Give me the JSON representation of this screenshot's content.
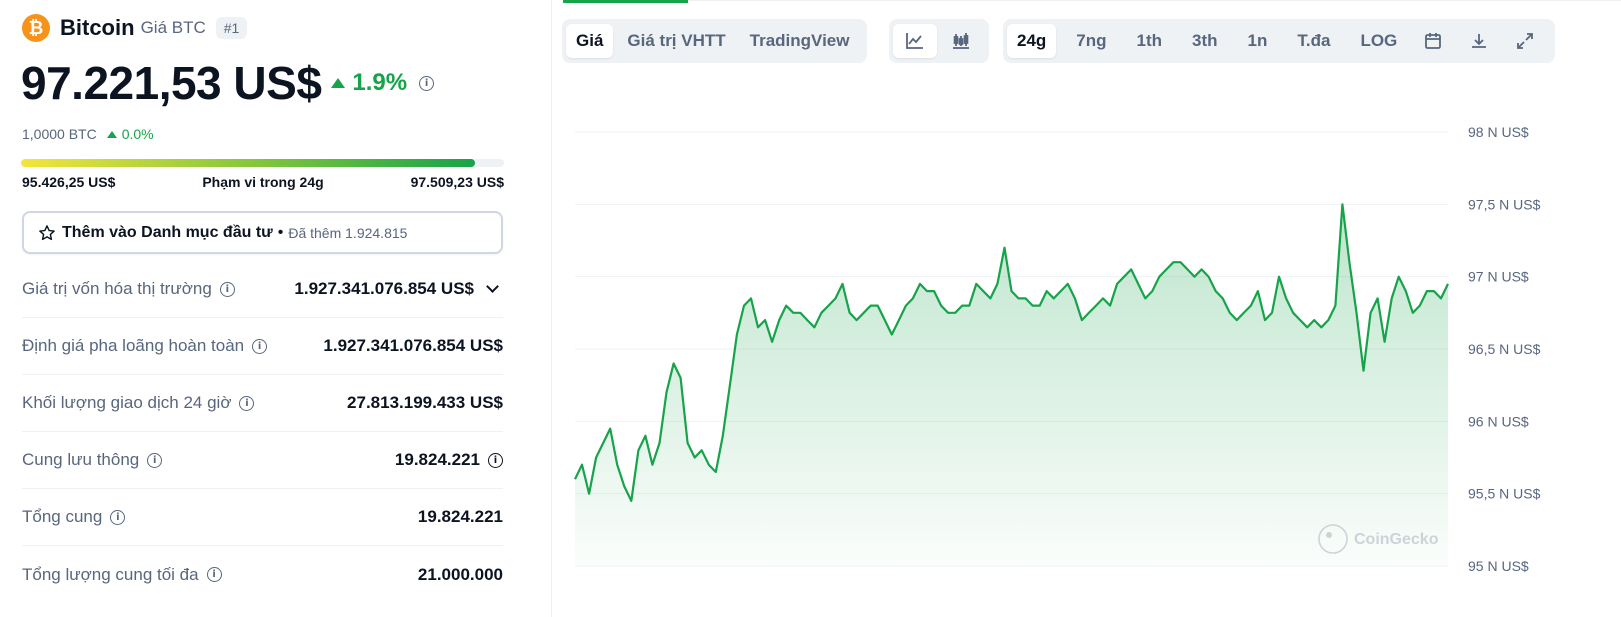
{
  "coin": {
    "logo_symbol": "₿",
    "name": "Bitcoin",
    "symbol_label": "Giá BTC",
    "rank": "#1",
    "price": "97.221,53 US$",
    "change": "1.9%",
    "btc_price": "1,0000 BTC",
    "btc_change": "0.0%"
  },
  "range": {
    "low": "95.426,25 US$",
    "label": "Phạm vi trong 24g",
    "high": "97.509,23 US$",
    "position_fraction": 0.94
  },
  "watchlist": {
    "label": "Thêm vào Danh mục đầu tư",
    "bullet": "•",
    "added": "Đã thêm 1.924.815"
  },
  "stats": [
    {
      "label": "Giá trị vốn hóa thị trường",
      "value": "1.927.341.076.854 US$"
    },
    {
      "label": "Định giá pha loãng hoàn toàn",
      "value": "1.927.341.076.854 US$"
    },
    {
      "label": "Khối lượng giao dịch 24 giờ",
      "value": "27.813.199.433 US$"
    },
    {
      "label": "Cung lưu thông",
      "value": "19.824.221"
    },
    {
      "label": "Tổng cung",
      "value": "19.824.221"
    },
    {
      "label": "Tổng lượng cung tối đa",
      "value": "21.000.000"
    }
  ],
  "toolbar": {
    "view_tabs": [
      "Giá",
      "Giá trị VHTT",
      "TradingView"
    ],
    "active_view": "Giá",
    "chart_icons": [
      "line-chart-icon",
      "candlestick-icon"
    ],
    "range_tabs": [
      "24g",
      "7ng",
      "1th",
      "3th",
      "1n",
      "T.đa",
      "LOG"
    ],
    "active_range": "24g",
    "action_icons": [
      "calendar-icon",
      "download-icon",
      "expand-icon"
    ]
  },
  "chart_data": {
    "type": "area",
    "y_tick_labels": [
      "98 N US$",
      "97,5 N US$",
      "97 N US$",
      "96,5 N US$",
      "96 N US$",
      "95,5 N US$",
      "95 N US$"
    ],
    "ylim": [
      95000,
      98000
    ],
    "grid": true,
    "watermark": "CoinGecko",
    "line_color": "#16a34a",
    "series": [
      {
        "values": [
          95600,
          95700,
          95500,
          95750,
          95850,
          95950,
          95700,
          95550,
          95450,
          95800,
          95900,
          95700,
          95850,
          96200,
          96400,
          96300,
          95850,
          95750,
          95800,
          95700,
          95650,
          95900,
          96250,
          96600,
          96800,
          96850,
          96650,
          96700,
          96550,
          96700,
          96800,
          96750,
          96750,
          96700,
          96650,
          96750,
          96800,
          96850,
          96950,
          96750,
          96700,
          96750,
          96800,
          96800,
          96700,
          96600,
          96700,
          96800,
          96850,
          96950,
          96900,
          96900,
          96800,
          96750,
          96750,
          96800,
          96800,
          96950,
          96900,
          96850,
          96950,
          97200,
          96900,
          96850,
          96850,
          96800,
          96800,
          96900,
          96850,
          96900,
          96950,
          96850,
          96700,
          96750,
          96800,
          96850,
          96800,
          96950,
          97000,
          97050,
          96950,
          96850,
          96900,
          97000,
          97050,
          97100,
          97100,
          97050,
          97000,
          97050,
          97000,
          96900,
          96850,
          96750,
          96700,
          96750,
          96800,
          96900,
          96700,
          96750,
          97000,
          96850,
          96750,
          96700,
          96650,
          96700,
          96650,
          96700,
          96800,
          97500,
          97100,
          96750,
          96350,
          96750,
          96850,
          96550,
          96850,
          97000,
          96900,
          96750,
          96800,
          96900,
          96900,
          96850,
          96950
        ]
      }
    ]
  }
}
